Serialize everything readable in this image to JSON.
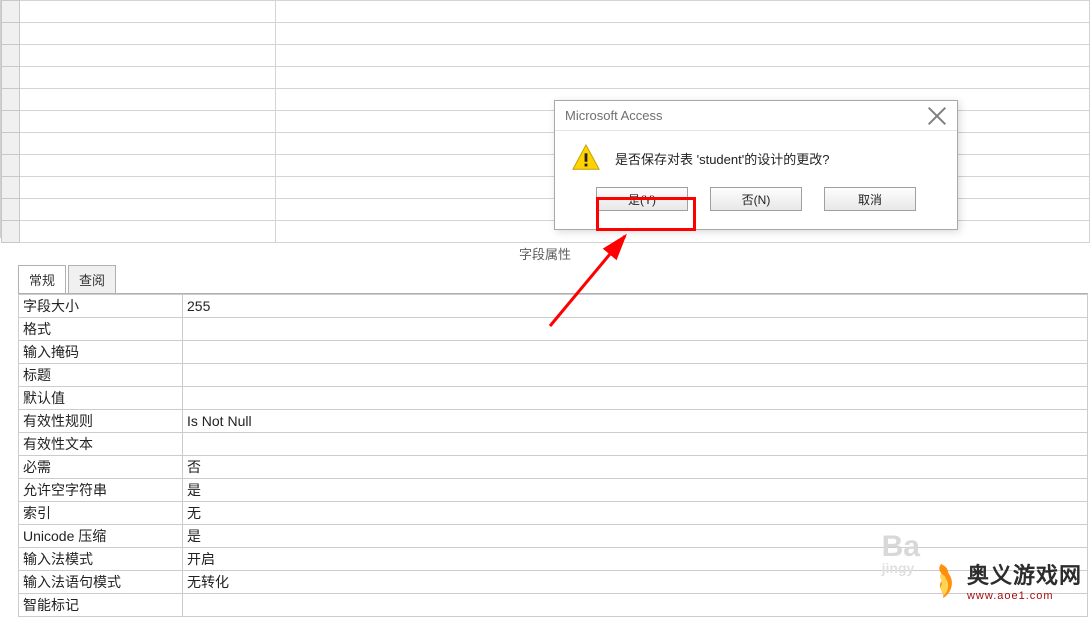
{
  "section_title": "字段属性",
  "tabs": {
    "general": "常规",
    "lookup": "查阅"
  },
  "properties": [
    {
      "label": "字段大小",
      "value": "255"
    },
    {
      "label": "格式",
      "value": ""
    },
    {
      "label": "输入掩码",
      "value": ""
    },
    {
      "label": "标题",
      "value": ""
    },
    {
      "label": "默认值",
      "value": ""
    },
    {
      "label": "有效性规则",
      "value": "Is Not Null"
    },
    {
      "label": "有效性文本",
      "value": ""
    },
    {
      "label": "必需",
      "value": "否"
    },
    {
      "label": "允许空字符串",
      "value": "是"
    },
    {
      "label": "索引",
      "value": "无"
    },
    {
      "label": "Unicode 压缩",
      "value": "是"
    },
    {
      "label": "输入法模式",
      "value": "开启"
    },
    {
      "label": "输入法语句模式",
      "value": "无转化"
    },
    {
      "label": "智能标记",
      "value": ""
    }
  ],
  "dialog": {
    "title": "Microsoft Access",
    "message": "是否保存对表 'student'的设计的更改?",
    "yes": "是(Y)",
    "no": "否(N)",
    "cancel": "取消"
  },
  "watermark": {
    "ba": "Ba",
    "jingy": "jingy",
    "site_name": "奥义游戏网",
    "site_url": "www.aoe1.com"
  }
}
